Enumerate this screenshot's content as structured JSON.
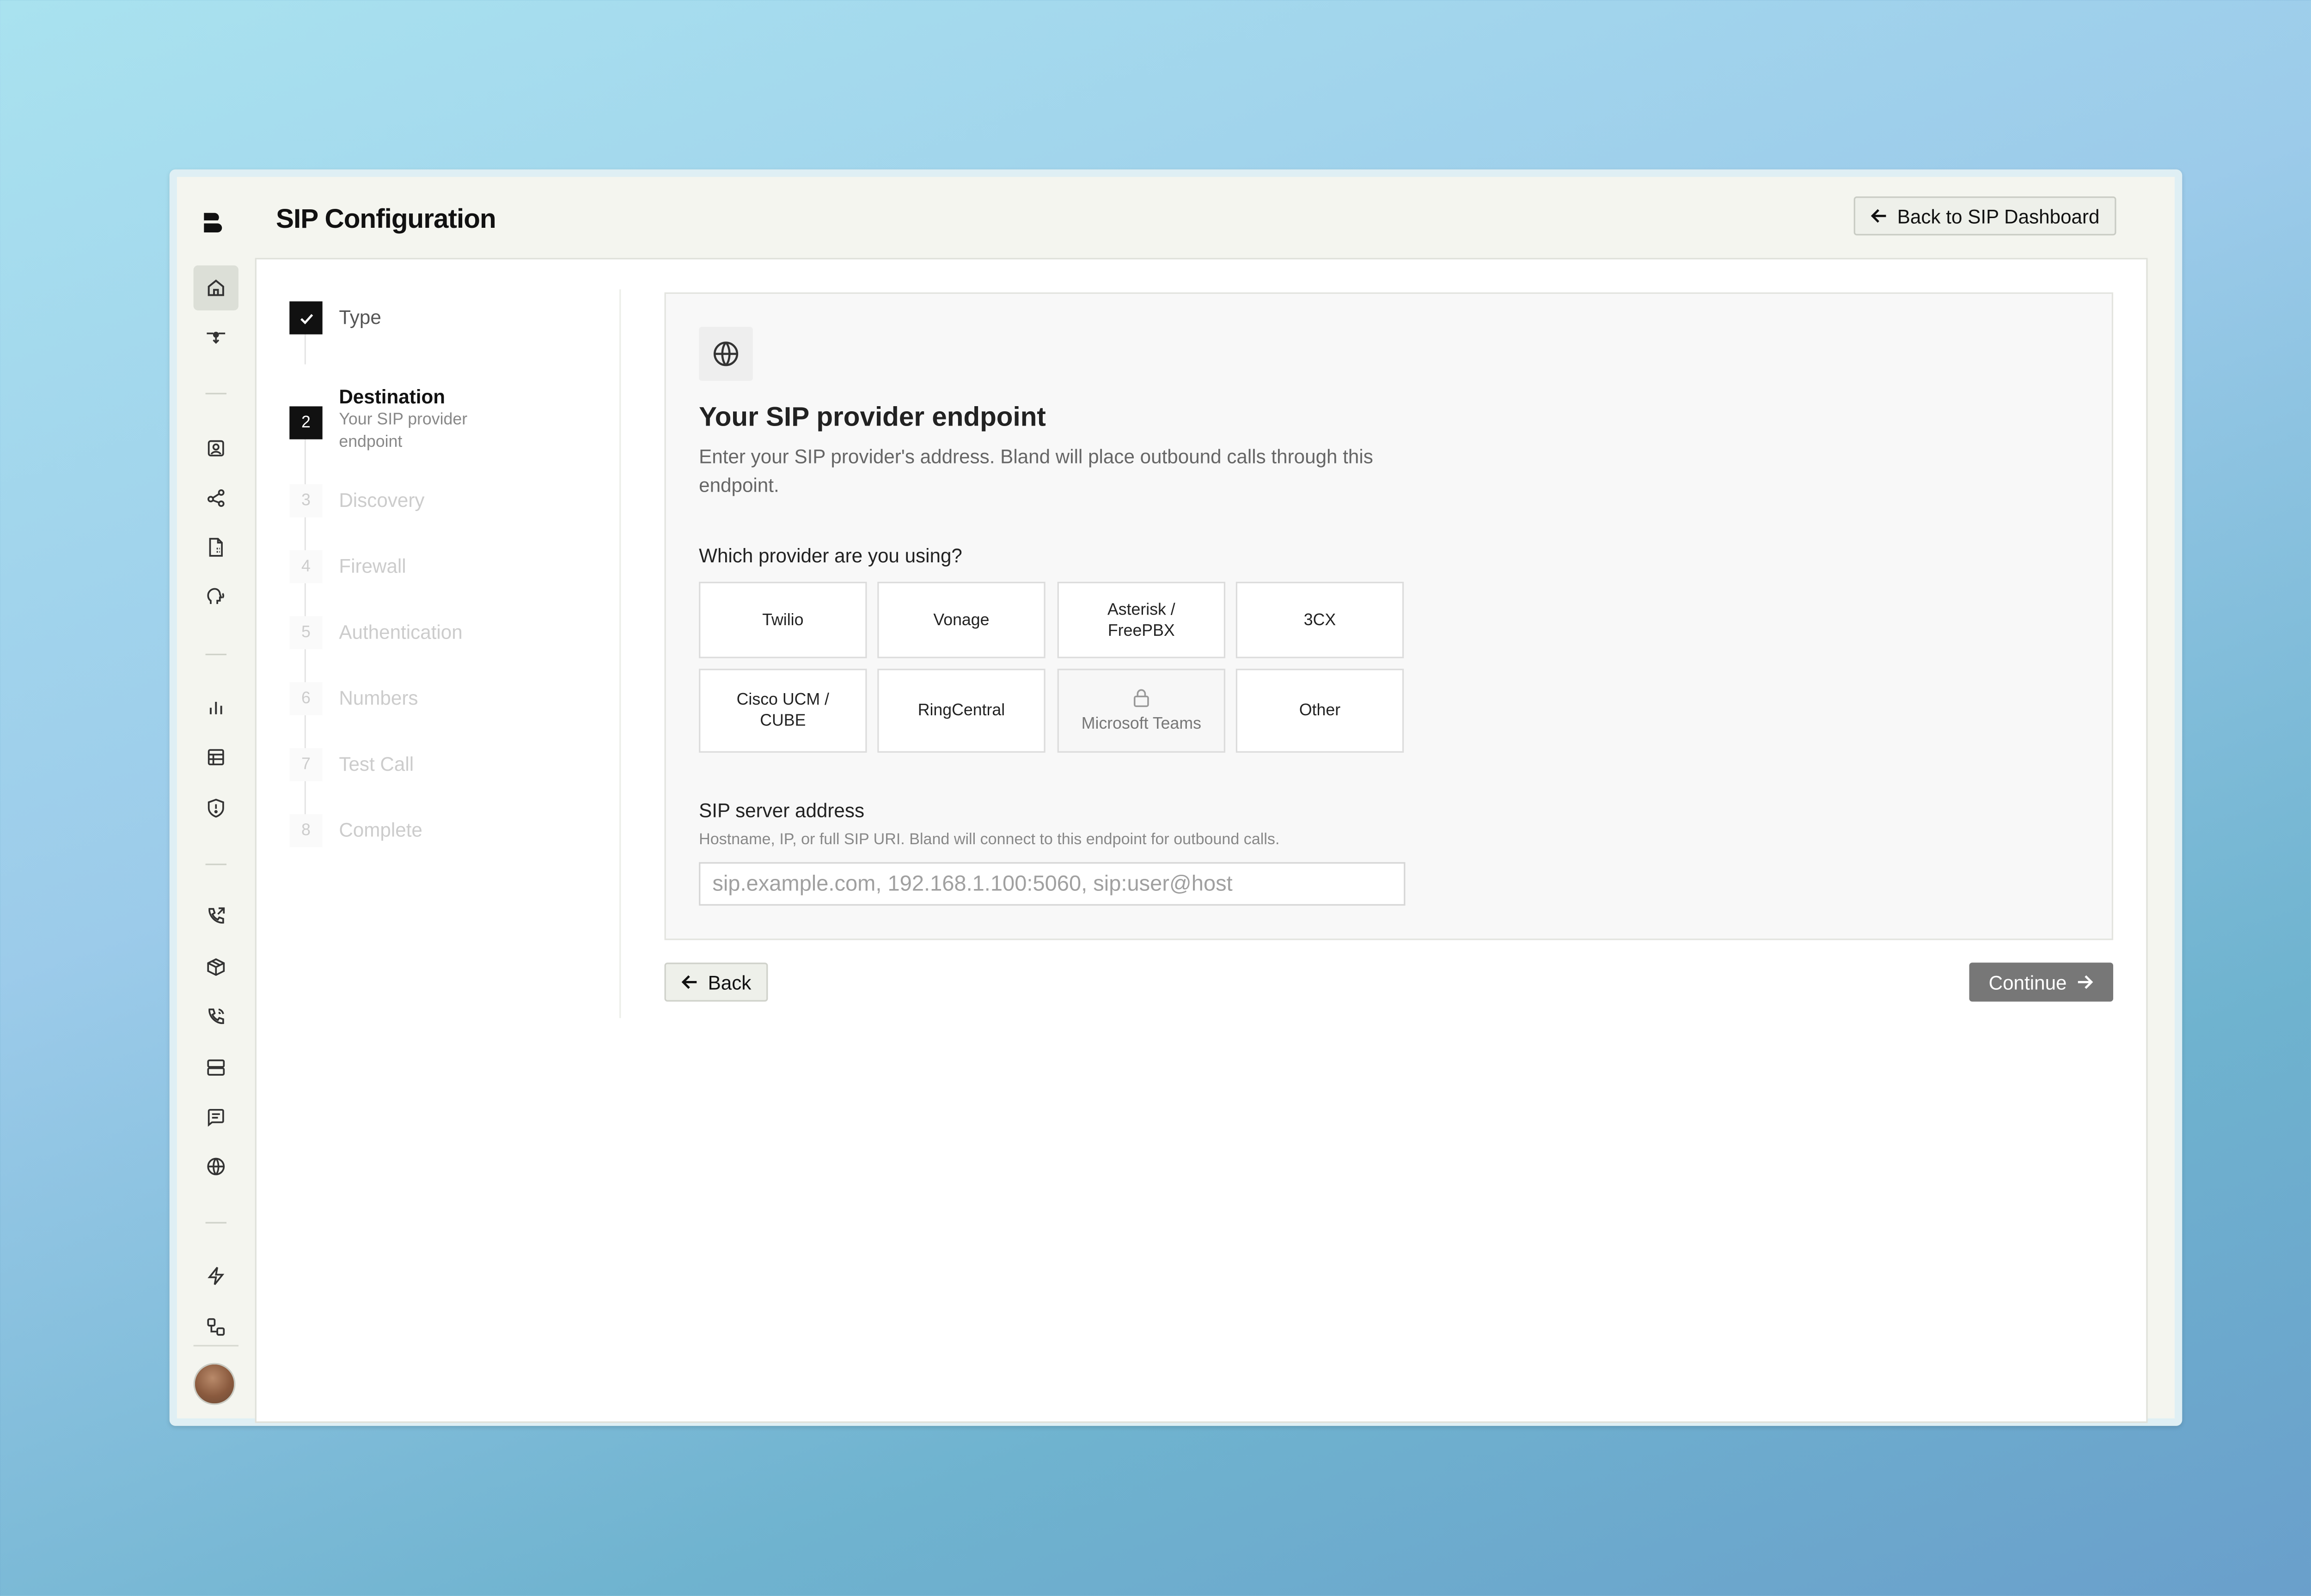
{
  "header": {
    "title": "SIP Configuration",
    "back_dashboard_label": "Back to SIP Dashboard"
  },
  "sidebar": {
    "icons": [
      "home-icon",
      "drone-icon",
      "contact-icon",
      "share-icon",
      "file-icon",
      "voice-icon",
      "bar-chart-icon",
      "table-icon",
      "shield-icon",
      "phone-outgoing-icon",
      "box-icon",
      "phone-icon",
      "server-icon",
      "message-icon",
      "globe-icon",
      "lightning-icon",
      "workflow-icon"
    ]
  },
  "steps": [
    {
      "num": "",
      "label": "Type",
      "state": "done"
    },
    {
      "num": "2",
      "label": "Destination",
      "sub": "Your SIP provider endpoint",
      "state": "current"
    },
    {
      "num": "3",
      "label": "Discovery",
      "state": "todo"
    },
    {
      "num": "4",
      "label": "Firewall",
      "state": "todo"
    },
    {
      "num": "5",
      "label": "Authentication",
      "state": "todo"
    },
    {
      "num": "6",
      "label": "Numbers",
      "state": "todo"
    },
    {
      "num": "7",
      "label": "Test Call",
      "state": "todo"
    },
    {
      "num": "8",
      "label": "Complete",
      "state": "todo"
    }
  ],
  "card": {
    "title": "Your SIP provider endpoint",
    "description": "Enter your SIP provider's address. Bland will place outbound calls through this endpoint.",
    "provider_question": "Which provider are you using?",
    "providers": [
      {
        "label": "Twilio"
      },
      {
        "label": "Vonage"
      },
      {
        "label": "Asterisk / FreePBX"
      },
      {
        "label": "3CX"
      },
      {
        "label": "Cisco UCM / CUBE"
      },
      {
        "label": "RingCentral"
      },
      {
        "label": "Microsoft Teams",
        "locked": true
      },
      {
        "label": "Other"
      }
    ],
    "sip_label": "SIP server address",
    "sip_hint": "Hostname, IP, or full SIP URI. Bland will connect to this endpoint for outbound calls.",
    "sip_value": "",
    "sip_placeholder": "sip.example.com, 192.168.1.100:5060, sip:user@host"
  },
  "footer": {
    "back_label": "Back",
    "continue_label": "Continue"
  },
  "colors": {
    "continue_bg": "#777777",
    "step_active_bg": "#111111",
    "window_bg": "#f4f5ef"
  }
}
